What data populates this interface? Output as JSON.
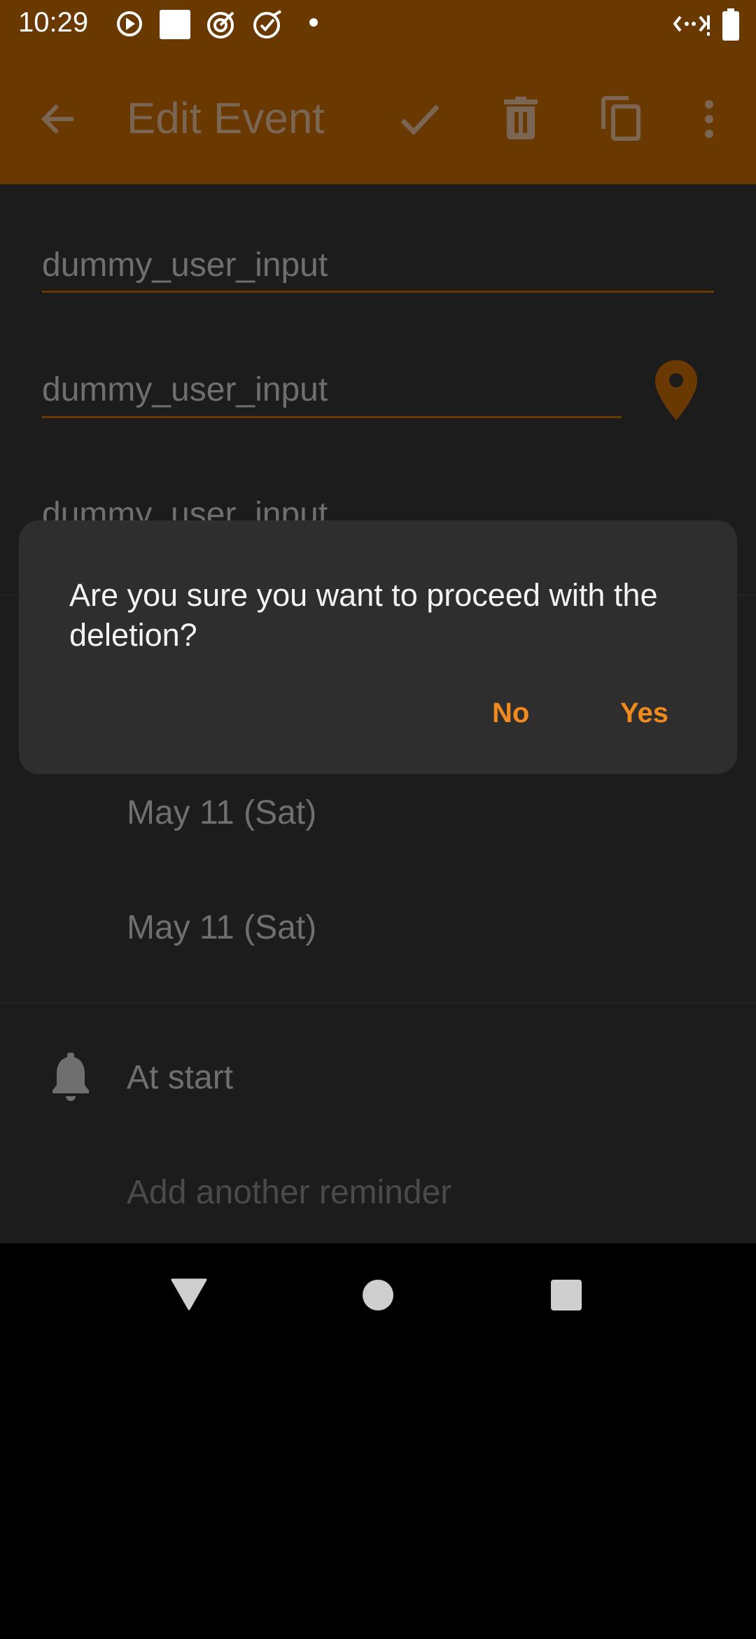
{
  "status_bar": {
    "time": "10:29"
  },
  "app_bar": {
    "title": "Edit Event",
    "icons": [
      "back-arrow-icon",
      "check-icon",
      "delete-icon",
      "copy-icon",
      "more-vert-icon"
    ]
  },
  "form": {
    "title_value": "dummy_user_input",
    "location_value": "dummy_user_input",
    "description_value": "dummy_user_input",
    "start_date": "May 11 (Sat)",
    "end_date": "May 11 (Sat)",
    "reminder": "At start",
    "add_reminder_hint": "Add another reminder"
  },
  "dialog": {
    "message": "Are you sure you want to proceed with the deletion?",
    "no_label": "No",
    "yes_label": "Yes"
  },
  "colors": {
    "accent": "#f08a1c",
    "app_bar": "#6a3801",
    "dialog_bg": "#2e2e2e",
    "scrim_bg": "#1c1c1c"
  }
}
